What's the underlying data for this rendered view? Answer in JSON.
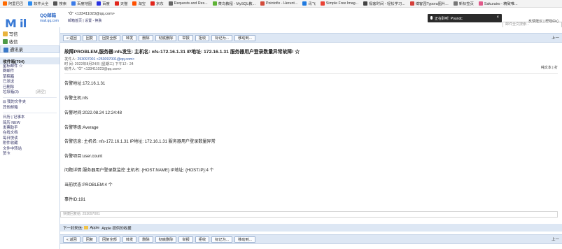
{
  "bookmarks": [
    {
      "label": "阿里巴巴",
      "color": "#ff6a00"
    },
    {
      "label": "软件大全",
      "color": "#2d8cf0"
    },
    {
      "label": "搜索",
      "color": "#555555"
    },
    {
      "label": "百度地图",
      "color": "#3b7be8"
    },
    {
      "label": "百度",
      "color": "#2932e1"
    },
    {
      "label": "天猫",
      "color": "#e1251b"
    },
    {
      "label": "淘宝",
      "color": "#ff5000"
    },
    {
      "label": "京东",
      "color": "#e1251b"
    },
    {
      "label": "Requests and Res...",
      "color": "#666666"
    },
    {
      "label": "菜鸟教程 - MySQL教...",
      "color": "#5fb336"
    },
    {
      "label": "Pointofix - Herunt...",
      "color": "#d24b3a"
    },
    {
      "label": "讯飞",
      "color": "#1f7ae0"
    },
    {
      "label": "Simple Free Imag...",
      "color": "#e94235"
    },
    {
      "label": "极客时间 - 轻松学习...",
      "color": "#444444"
    },
    {
      "label": "博客园Typora图片...",
      "color": "#d43f3a"
    },
    {
      "label": "新标签页",
      "color": "#777777"
    },
    {
      "label": "Sakurairo - 精致唯...",
      "color": "#e05a8a"
    }
  ],
  "header": {
    "logo_text": "M  il",
    "logo_brand": "QQ邮箱",
    "logo_domain": "mail.qq.com",
    "user": "\"Ö\" <133411023@qq.com>",
    "user_links": "邮箱首页 | 设置 - 换肤",
    "toplinks": "反馈建议 | 帮助中心",
    "search_placeholder": "邮件全文搜索..."
  },
  "toast": {
    "label": "正在聆听: Poundc"
  },
  "nav": [
    {
      "label": "写信",
      "icon": "pen-icon",
      "color": "#e9b33d"
    },
    {
      "label": "收信",
      "icon": "inbox-icon",
      "color": "#4f9b47"
    },
    {
      "label": "通讯录",
      "icon": "contacts-icon",
      "color": "#3a78c7"
    }
  ],
  "folders": {
    "inbox": "收件箱(704)",
    "items": [
      "星标邮件 ☆",
      "群邮件",
      "草稿箱",
      "已发送",
      "已删除",
      "垃圾箱(3)"
    ],
    "clear_label": "[清空]",
    "group_title": "⊟ 我的文件夹",
    "other_label": "其他邮箱",
    "extra": [
      "日历 | 记事本",
      "简历 NEW",
      "发票助手",
      "在线文档",
      "每日悦读",
      "附件收藏",
      "文件中转站",
      "贺卡"
    ]
  },
  "toolbar": {
    "buttons": [
      "« 返回",
      "回复",
      "回复全部",
      "转发",
      "删除",
      "彻底删除",
      "举报",
      "拒收",
      "标记为...",
      "移动到..."
    ],
    "nav_right": "上一"
  },
  "email": {
    "subject": "故障PROBLEM,服务器:nfs发生: 主机名: nfs-172.16.1.31 IP地址: 172.16.1.31 服务器用户登录数量异常故障! ☆",
    "from_label": "发件人:",
    "from_value": "253097001 <253097001@qq.com>",
    "date_label": "时  间:",
    "date_value": "2022年8月24日 (星期三) 下午12 : 24",
    "to_label": "收件人:",
    "to_value": "\"Ö\" <133411023@qq.com>",
    "print_links": "纯文本 | 打",
    "body": [
      "告警地址:172.16.1.31",
      "告警主机:nfs",
      "告警时间:2022.08.24 12:24:48",
      "告警等级:Average",
      "告警信息: 主机名: nfs-172.16.1.31 IP地址: 172.16.1.31 服务器用户登录数量异常",
      "告警项目:user.count",
      "问题详情:服务器用户登录数监控 主机名: {HOST.NAME} IP地址: {HOST.IP}:4 个",
      "当前状态:PROBLEM:4 个",
      "事件ID:191"
    ]
  },
  "quick_reply": {
    "placeholder": "快捷回复给: 253097001"
  },
  "next_mail": {
    "label": "下一封来信:",
    "sender": "Apple",
    "subject": "Apple 提供的收据"
  }
}
